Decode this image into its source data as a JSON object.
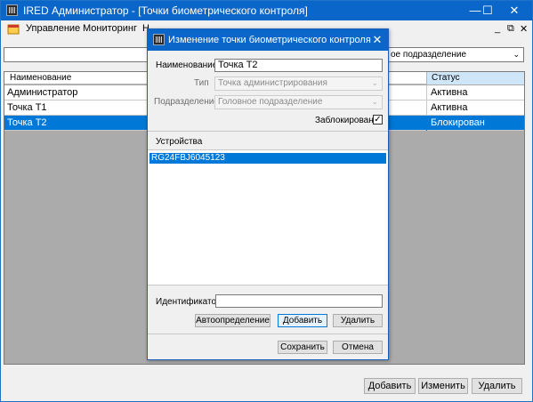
{
  "main": {
    "title": "IRED Администратор - [Точки биометрического контроля]",
    "window_buttons": {
      "minimize": "—",
      "maximize": "☐",
      "close": "✕"
    },
    "menu": [
      "Управление",
      "Мониторинг",
      "Н"
    ],
    "mdi_buttons": {
      "minimize": "_",
      "restore": "⧉",
      "close": "✕"
    },
    "filter_select": "ое подразделение",
    "grid": {
      "columns": [
        "Наименование",
        "Статус"
      ],
      "rows": [
        {
          "name": "Администратор",
          "status": "Активна"
        },
        {
          "name": "Точка Т1",
          "status": "Активна"
        },
        {
          "name": "Точка Т2",
          "status": "Блокирован",
          "selected": true
        }
      ]
    },
    "buttons": {
      "add": "Добавить",
      "edit": "Изменить",
      "delete": "Удалить"
    }
  },
  "dialog": {
    "title": "Изменение точки биометрического контроля",
    "close": "✕",
    "name_label": "Наименование",
    "name_value": "Точка Т2",
    "type_label": "Тип",
    "type_value": "Точка администрирования",
    "division_label": "Подразделение",
    "division_value": "Головное подразделение",
    "blocked_label": "Заблокирована",
    "blocked_checked": "✓",
    "devices_header": "Устройства",
    "devices": [
      "RG24FBJ6045123"
    ],
    "identifier_label": "Идентификатор",
    "identifier_value": "",
    "buttons": {
      "autodetect": "Автоопределение",
      "add": "Добавить",
      "delete": "Удалить",
      "save": "Сохранить",
      "cancel": "Отмена"
    }
  },
  "colors": {
    "titlebar": "#0a66c8",
    "selection": "#0078d7",
    "grid_background": "#ababab"
  }
}
